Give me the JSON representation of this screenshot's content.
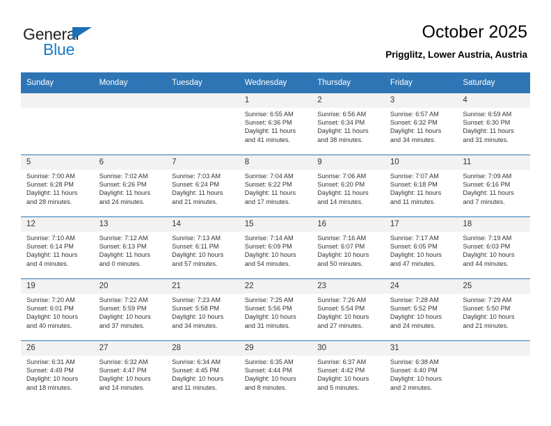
{
  "brand": {
    "name_part1": "General",
    "name_part2": "Blue",
    "triangle_color": "#1b6fb5",
    "blue_color": "#1b7ac4"
  },
  "header": {
    "title": "October 2025",
    "subtitle": "Prigglitz, Lower Austria, Austria"
  },
  "theme": {
    "header_bg": "#2e75b6",
    "header_text": "#ffffff",
    "daynum_bg": "#f2f2f2",
    "cell_bg": "#ffffff",
    "text": "#333333"
  },
  "weekdays": [
    "Sunday",
    "Monday",
    "Tuesday",
    "Wednesday",
    "Thursday",
    "Friday",
    "Saturday"
  ],
  "labels": {
    "sunrise": "Sunrise:",
    "sunset": "Sunset:",
    "daylight": "Daylight:"
  },
  "weeks": [
    [
      {
        "day": "",
        "sunrise": "",
        "sunset": "",
        "daylight_line1": "",
        "daylight_line2": "",
        "empty": true
      },
      {
        "day": "",
        "sunrise": "",
        "sunset": "",
        "daylight_line1": "",
        "daylight_line2": "",
        "empty": true
      },
      {
        "day": "",
        "sunrise": "",
        "sunset": "",
        "daylight_line1": "",
        "daylight_line2": "",
        "empty": true
      },
      {
        "day": "1",
        "sunrise": "Sunrise: 6:55 AM",
        "sunset": "Sunset: 6:36 PM",
        "daylight_line1": "Daylight: 11 hours",
        "daylight_line2": "and 41 minutes."
      },
      {
        "day": "2",
        "sunrise": "Sunrise: 6:56 AM",
        "sunset": "Sunset: 6:34 PM",
        "daylight_line1": "Daylight: 11 hours",
        "daylight_line2": "and 38 minutes."
      },
      {
        "day": "3",
        "sunrise": "Sunrise: 6:57 AM",
        "sunset": "Sunset: 6:32 PM",
        "daylight_line1": "Daylight: 11 hours",
        "daylight_line2": "and 34 minutes."
      },
      {
        "day": "4",
        "sunrise": "Sunrise: 6:59 AM",
        "sunset": "Sunset: 6:30 PM",
        "daylight_line1": "Daylight: 11 hours",
        "daylight_line2": "and 31 minutes."
      }
    ],
    [
      {
        "day": "5",
        "sunrise": "Sunrise: 7:00 AM",
        "sunset": "Sunset: 6:28 PM",
        "daylight_line1": "Daylight: 11 hours",
        "daylight_line2": "and 28 minutes."
      },
      {
        "day": "6",
        "sunrise": "Sunrise: 7:02 AM",
        "sunset": "Sunset: 6:26 PM",
        "daylight_line1": "Daylight: 11 hours",
        "daylight_line2": "and 24 minutes."
      },
      {
        "day": "7",
        "sunrise": "Sunrise: 7:03 AM",
        "sunset": "Sunset: 6:24 PM",
        "daylight_line1": "Daylight: 11 hours",
        "daylight_line2": "and 21 minutes."
      },
      {
        "day": "8",
        "sunrise": "Sunrise: 7:04 AM",
        "sunset": "Sunset: 6:22 PM",
        "daylight_line1": "Daylight: 11 hours",
        "daylight_line2": "and 17 minutes."
      },
      {
        "day": "9",
        "sunrise": "Sunrise: 7:06 AM",
        "sunset": "Sunset: 6:20 PM",
        "daylight_line1": "Daylight: 11 hours",
        "daylight_line2": "and 14 minutes."
      },
      {
        "day": "10",
        "sunrise": "Sunrise: 7:07 AM",
        "sunset": "Sunset: 6:18 PM",
        "daylight_line1": "Daylight: 11 hours",
        "daylight_line2": "and 11 minutes."
      },
      {
        "day": "11",
        "sunrise": "Sunrise: 7:09 AM",
        "sunset": "Sunset: 6:16 PM",
        "daylight_line1": "Daylight: 11 hours",
        "daylight_line2": "and 7 minutes."
      }
    ],
    [
      {
        "day": "12",
        "sunrise": "Sunrise: 7:10 AM",
        "sunset": "Sunset: 6:14 PM",
        "daylight_line1": "Daylight: 11 hours",
        "daylight_line2": "and 4 minutes."
      },
      {
        "day": "13",
        "sunrise": "Sunrise: 7:12 AM",
        "sunset": "Sunset: 6:13 PM",
        "daylight_line1": "Daylight: 11 hours",
        "daylight_line2": "and 0 minutes."
      },
      {
        "day": "14",
        "sunrise": "Sunrise: 7:13 AM",
        "sunset": "Sunset: 6:11 PM",
        "daylight_line1": "Daylight: 10 hours",
        "daylight_line2": "and 57 minutes."
      },
      {
        "day": "15",
        "sunrise": "Sunrise: 7:14 AM",
        "sunset": "Sunset: 6:09 PM",
        "daylight_line1": "Daylight: 10 hours",
        "daylight_line2": "and 54 minutes."
      },
      {
        "day": "16",
        "sunrise": "Sunrise: 7:16 AM",
        "sunset": "Sunset: 6:07 PM",
        "daylight_line1": "Daylight: 10 hours",
        "daylight_line2": "and 50 minutes."
      },
      {
        "day": "17",
        "sunrise": "Sunrise: 7:17 AM",
        "sunset": "Sunset: 6:05 PM",
        "daylight_line1": "Daylight: 10 hours",
        "daylight_line2": "and 47 minutes."
      },
      {
        "day": "18",
        "sunrise": "Sunrise: 7:19 AM",
        "sunset": "Sunset: 6:03 PM",
        "daylight_line1": "Daylight: 10 hours",
        "daylight_line2": "and 44 minutes."
      }
    ],
    [
      {
        "day": "19",
        "sunrise": "Sunrise: 7:20 AM",
        "sunset": "Sunset: 6:01 PM",
        "daylight_line1": "Daylight: 10 hours",
        "daylight_line2": "and 40 minutes."
      },
      {
        "day": "20",
        "sunrise": "Sunrise: 7:22 AM",
        "sunset": "Sunset: 5:59 PM",
        "daylight_line1": "Daylight: 10 hours",
        "daylight_line2": "and 37 minutes."
      },
      {
        "day": "21",
        "sunrise": "Sunrise: 7:23 AM",
        "sunset": "Sunset: 5:58 PM",
        "daylight_line1": "Daylight: 10 hours",
        "daylight_line2": "and 34 minutes."
      },
      {
        "day": "22",
        "sunrise": "Sunrise: 7:25 AM",
        "sunset": "Sunset: 5:56 PM",
        "daylight_line1": "Daylight: 10 hours",
        "daylight_line2": "and 31 minutes."
      },
      {
        "day": "23",
        "sunrise": "Sunrise: 7:26 AM",
        "sunset": "Sunset: 5:54 PM",
        "daylight_line1": "Daylight: 10 hours",
        "daylight_line2": "and 27 minutes."
      },
      {
        "day": "24",
        "sunrise": "Sunrise: 7:28 AM",
        "sunset": "Sunset: 5:52 PM",
        "daylight_line1": "Daylight: 10 hours",
        "daylight_line2": "and 24 minutes."
      },
      {
        "day": "25",
        "sunrise": "Sunrise: 7:29 AM",
        "sunset": "Sunset: 5:50 PM",
        "daylight_line1": "Daylight: 10 hours",
        "daylight_line2": "and 21 minutes."
      }
    ],
    [
      {
        "day": "26",
        "sunrise": "Sunrise: 6:31 AM",
        "sunset": "Sunset: 4:49 PM",
        "daylight_line1": "Daylight: 10 hours",
        "daylight_line2": "and 18 minutes."
      },
      {
        "day": "27",
        "sunrise": "Sunrise: 6:32 AM",
        "sunset": "Sunset: 4:47 PM",
        "daylight_line1": "Daylight: 10 hours",
        "daylight_line2": "and 14 minutes."
      },
      {
        "day": "28",
        "sunrise": "Sunrise: 6:34 AM",
        "sunset": "Sunset: 4:45 PM",
        "daylight_line1": "Daylight: 10 hours",
        "daylight_line2": "and 11 minutes."
      },
      {
        "day": "29",
        "sunrise": "Sunrise: 6:35 AM",
        "sunset": "Sunset: 4:44 PM",
        "daylight_line1": "Daylight: 10 hours",
        "daylight_line2": "and 8 minutes."
      },
      {
        "day": "30",
        "sunrise": "Sunrise: 6:37 AM",
        "sunset": "Sunset: 4:42 PM",
        "daylight_line1": "Daylight: 10 hours",
        "daylight_line2": "and 5 minutes."
      },
      {
        "day": "31",
        "sunrise": "Sunrise: 6:38 AM",
        "sunset": "Sunset: 4:40 PM",
        "daylight_line1": "Daylight: 10 hours",
        "daylight_line2": "and 2 minutes."
      },
      {
        "day": "",
        "sunrise": "",
        "sunset": "",
        "daylight_line1": "",
        "daylight_line2": "",
        "empty": true
      }
    ]
  ]
}
